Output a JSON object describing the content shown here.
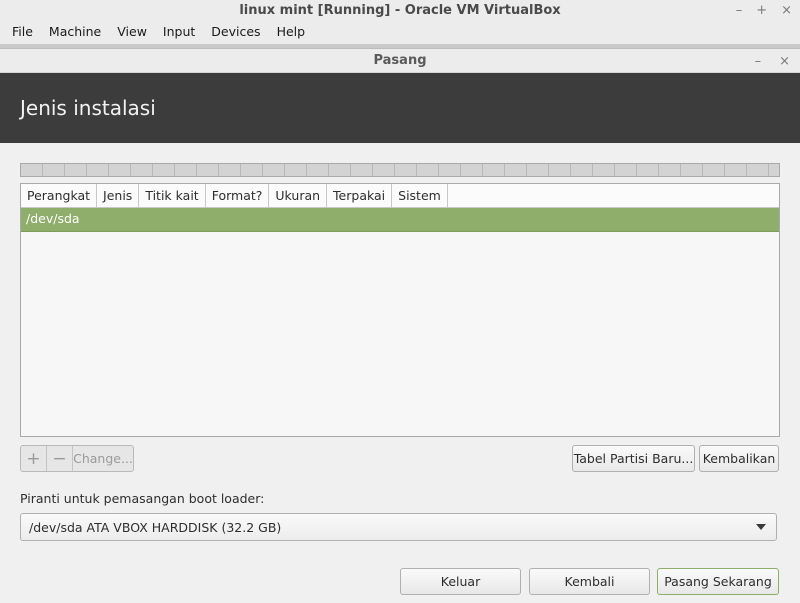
{
  "vbox": {
    "title": "linux mint [Running] - Oracle VM VirtualBox",
    "controls": [
      "–",
      "+",
      "×"
    ],
    "menu": [
      "File",
      "Machine",
      "View",
      "Input",
      "Devices",
      "Help"
    ]
  },
  "dialog": {
    "title": "Pasang",
    "controls": [
      "–",
      "×"
    ],
    "header_title": "Jenis instalasi"
  },
  "table": {
    "columns": [
      "Perangkat",
      "Jenis",
      "Titik kait",
      "Format?",
      "Ukuran",
      "Terpakai",
      "Sistem"
    ],
    "rows": [
      {
        "device": "/dev/sda",
        "selected": true
      }
    ]
  },
  "partition_buttons": {
    "add_icon": "+",
    "remove_icon": "−",
    "change_label": "Change..."
  },
  "new_table_label": "Tabel Partisi Baru...",
  "revert_label": "Kembalikan",
  "boot_loader": {
    "label": "Piranti untuk pemasangan boot loader:",
    "selected": "/dev/sda ATA VBOX HARDDISK (32.2 GB)"
  },
  "footer": {
    "quit_label": "Keluar",
    "back_label": "Kembali",
    "install_label": "Pasang Sekarang"
  },
  "colors": {
    "header_bg": "#3c3c3c",
    "selected_row": "#8fad6b",
    "primary_border": "#8fad6b"
  }
}
